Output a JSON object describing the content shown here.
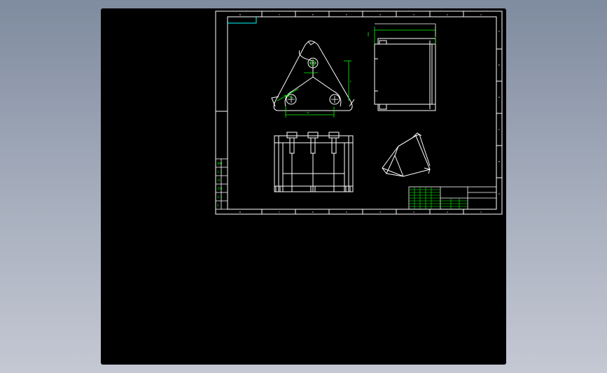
{
  "viewer": {
    "background_gradient": [
      "#7f8b9f",
      "#c4c8d3"
    ],
    "canvas_color": "#000000",
    "line_color": "#ffffff",
    "dimension_color": "#00ff00",
    "highlight_color": "#00ffff"
  },
  "drawing": {
    "border_letters_top": [
      "8",
      "7",
      "6",
      "5",
      "4",
      "3",
      "2",
      "1"
    ],
    "border_letters_bottom": [
      "8",
      "7",
      "6",
      "5",
      "4",
      "3",
      "2",
      "1"
    ],
    "border_numbers_right": [
      "F",
      "E",
      "D",
      "C",
      "B",
      "A"
    ],
    "left_table_values": [
      "300",
      "1.5",
      "12",
      "150",
      "1:2",
      "3"
    ]
  }
}
